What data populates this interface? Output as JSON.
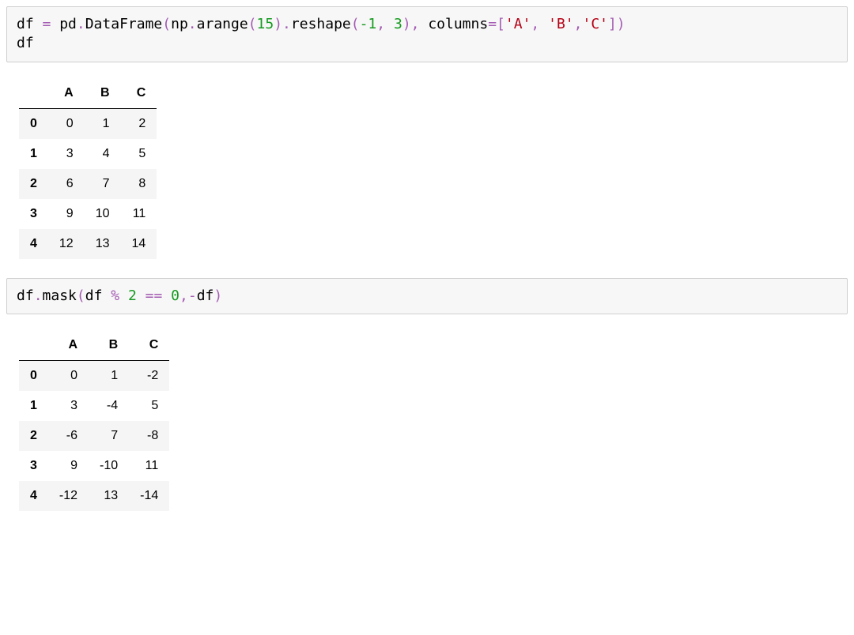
{
  "code1_tokens": [
    {
      "t": "df ",
      "c": ""
    },
    {
      "t": "=",
      "c": "op"
    },
    {
      "t": " pd",
      "c": ""
    },
    {
      "t": ".",
      "c": "op"
    },
    {
      "t": "DataFrame",
      "c": ""
    },
    {
      "t": "(",
      "c": "op"
    },
    {
      "t": "np",
      "c": ""
    },
    {
      "t": ".",
      "c": "op"
    },
    {
      "t": "arange",
      "c": ""
    },
    {
      "t": "(",
      "c": "op"
    },
    {
      "t": "15",
      "c": "num"
    },
    {
      "t": ")",
      "c": "op"
    },
    {
      "t": ".",
      "c": "op"
    },
    {
      "t": "reshape",
      "c": ""
    },
    {
      "t": "(",
      "c": "op"
    },
    {
      "t": "-1",
      "c": "num"
    },
    {
      "t": ",",
      "c": "op"
    },
    {
      "t": " ",
      "c": ""
    },
    {
      "t": "3",
      "c": "num"
    },
    {
      "t": ")",
      "c": "op"
    },
    {
      "t": ",",
      "c": "op"
    },
    {
      "t": " columns",
      "c": ""
    },
    {
      "t": "=",
      "c": "op"
    },
    {
      "t": "[",
      "c": "op"
    },
    {
      "t": "'",
      "c": "kstr"
    },
    {
      "t": "A",
      "c": "kstr"
    },
    {
      "t": "'",
      "c": "kstr"
    },
    {
      "t": ",",
      "c": "op"
    },
    {
      "t": " ",
      "c": ""
    },
    {
      "t": "'",
      "c": "kstr"
    },
    {
      "t": "B",
      "c": "kstr"
    },
    {
      "t": "'",
      "c": "kstr"
    },
    {
      "t": ",",
      "c": "op"
    },
    {
      "t": "'",
      "c": "kstr"
    },
    {
      "t": "C",
      "c": "kstr"
    },
    {
      "t": "'",
      "c": "kstr"
    },
    {
      "t": "]",
      "c": "op"
    },
    {
      "t": ")",
      "c": "op"
    },
    {
      "t": "\n",
      "c": ""
    },
    {
      "t": "df",
      "c": ""
    }
  ],
  "code2_tokens": [
    {
      "t": "df",
      "c": ""
    },
    {
      "t": ".",
      "c": "op"
    },
    {
      "t": "mask",
      "c": ""
    },
    {
      "t": "(",
      "c": "op"
    },
    {
      "t": "df ",
      "c": ""
    },
    {
      "t": "%",
      "c": "op"
    },
    {
      "t": " ",
      "c": ""
    },
    {
      "t": "2",
      "c": "num"
    },
    {
      "t": " ",
      "c": ""
    },
    {
      "t": "==",
      "c": "op"
    },
    {
      "t": " ",
      "c": ""
    },
    {
      "t": "0",
      "c": "num"
    },
    {
      "t": ",",
      "c": "op"
    },
    {
      "t": "-",
      "c": "op"
    },
    {
      "t": "df",
      "c": ""
    },
    {
      "t": ")",
      "c": "op"
    }
  ],
  "chart_data": [
    {
      "type": "table",
      "title": "df",
      "columns": [
        "A",
        "B",
        "C"
      ],
      "index": [
        "0",
        "1",
        "2",
        "3",
        "4"
      ],
      "values": [
        [
          0,
          1,
          2
        ],
        [
          3,
          4,
          5
        ],
        [
          6,
          7,
          8
        ],
        [
          9,
          10,
          11
        ],
        [
          12,
          13,
          14
        ]
      ]
    },
    {
      "type": "table",
      "title": "df.mask(df % 2 == 0, -df)",
      "columns": [
        "A",
        "B",
        "C"
      ],
      "index": [
        "0",
        "1",
        "2",
        "3",
        "4"
      ],
      "values": [
        [
          0,
          1,
          -2
        ],
        [
          3,
          -4,
          5
        ],
        [
          -6,
          7,
          -8
        ],
        [
          9,
          -10,
          11
        ],
        [
          -12,
          13,
          -14
        ]
      ]
    }
  ]
}
